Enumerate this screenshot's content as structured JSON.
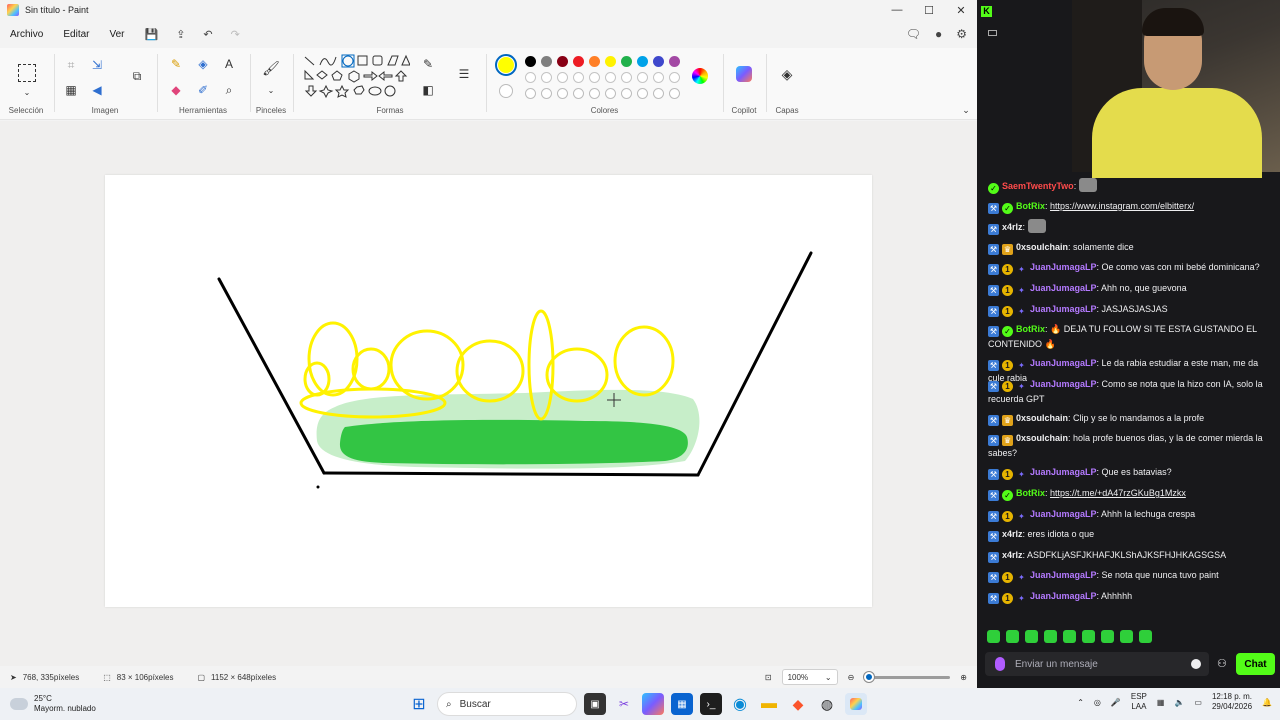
{
  "paint": {
    "title": "Sin título - Paint",
    "window_controls": {
      "minimize": "—",
      "maximize": "☐",
      "close": "✕"
    },
    "menu": [
      "Archivo",
      "Editar",
      "Ver"
    ],
    "groups": {
      "seleccion": "Selección",
      "imagen": "Imagen",
      "herramientas": "Herramientas",
      "pinceles": "Pinceles",
      "formas": "Formas",
      "colores": "Colores",
      "copilot": "Copilot",
      "capas": "Capas"
    },
    "active_color": "#ffff00",
    "palette": [
      "#000000",
      "#7f7f7f",
      "#880015",
      "#ed1c24",
      "#ff7f27",
      "#fff200",
      "#22b14c",
      "#00a2e8",
      "#3f48cc",
      "#a349a4",
      "#ffffff",
      "#c3c3c3",
      "#b97a57",
      "#ffaec9",
      "#ffc90e",
      "#efe4b0",
      "#b5e61d",
      "#99d9ea",
      "#7092be",
      "#c8bfe7"
    ],
    "status": {
      "cursor_pos": "768, 335píxeles",
      "selection_size": "83 × 106píxeles",
      "canvas_size": "1152 × 648píxeles",
      "zoom": "100%"
    },
    "zoom_fraction": 0.05
  },
  "stream": {
    "chat": [
      {
        "user": "SaemTwentyTwo",
        "color": "#ff4b4b",
        "badges": [
          "green"
        ],
        "text": "",
        "emote": true
      },
      {
        "user": "BotRix",
        "color": "#53fc18",
        "badges": [
          "blue",
          "green"
        ],
        "text": "https://www.instagram.com/elbitterx/",
        "link": true
      },
      {
        "user": "x4rlz",
        "color": "#efeff1",
        "badges": [
          "blue"
        ],
        "text": "",
        "emote": true
      },
      {
        "user": "0xsoulchain",
        "color": "#efeff1",
        "badges": [
          "blue",
          "crown"
        ],
        "text": "solamente dice"
      },
      {
        "user": "JuanJumagaLP",
        "color": "#b47aff",
        "badges": [
          "blue",
          "gold",
          "star"
        ],
        "text": "Oe como vas con mi bebé dominicana?"
      },
      {
        "user": "JuanJumagaLP",
        "color": "#b47aff",
        "badges": [
          "blue",
          "gold",
          "star"
        ],
        "text": "Ahh no, que guevona"
      },
      {
        "user": "JuanJumagaLP",
        "color": "#b47aff",
        "badges": [
          "blue",
          "gold",
          "star"
        ],
        "text": "JASJASJASJAS"
      },
      {
        "user": "BotRix",
        "color": "#53fc18",
        "badges": [
          "blue",
          "green"
        ],
        "text": "🔥 DEJA TU FOLLOW SI TE ESTA GUSTANDO EL CONTENIDO 🔥"
      },
      {
        "user": "JuanJumagaLP",
        "color": "#b47aff",
        "badges": [
          "blue",
          "gold",
          "star"
        ],
        "text": "Le da rabia estudiar a este man, me da cule rabia"
      },
      {
        "user": "JuanJumagaLP",
        "color": "#b47aff",
        "badges": [
          "blue",
          "gold",
          "star"
        ],
        "text": "Como se nota que la hizo con IA, solo la recuerda GPT"
      },
      {
        "user": "0xsoulchain",
        "color": "#efeff1",
        "badges": [
          "blue",
          "crown"
        ],
        "text": "Clip y se lo mandamos a la profe"
      },
      {
        "user": "0xsoulchain",
        "color": "#efeff1",
        "badges": [
          "blue",
          "crown"
        ],
        "text": "hola profe buenos dias, y la de comer mierda la sabes?"
      },
      {
        "user": "JuanJumagaLP",
        "color": "#b47aff",
        "badges": [
          "blue",
          "gold",
          "star"
        ],
        "text": "Que es batavias?"
      },
      {
        "user": "BotRix",
        "color": "#53fc18",
        "badges": [
          "blue",
          "green"
        ],
        "text": "https://t.me/+dA47rzGKuBg1Mzkx",
        "link": true
      },
      {
        "user": "JuanJumagaLP",
        "color": "#b47aff",
        "badges": [
          "blue",
          "gold",
          "star"
        ],
        "text": "Ahhh la lechuga crespa"
      },
      {
        "user": "x4rlz",
        "color": "#efeff1",
        "badges": [
          "blue"
        ],
        "text": "eres idiota o que"
      },
      {
        "user": "x4rlz",
        "color": "#efeff1",
        "badges": [
          "blue"
        ],
        "text": "ASDFKLjASFJKHAFJKLShAJKSFHJHKAGSGSA"
      },
      {
        "user": "JuanJumagaLP",
        "color": "#b47aff",
        "badges": [
          "blue",
          "gold",
          "star"
        ],
        "text": "Se nota que nunca tuvo paint"
      },
      {
        "user": "JuanJumagaLP",
        "color": "#b47aff",
        "badges": [
          "blue",
          "gold",
          "star"
        ],
        "text": "Ahhhhh"
      }
    ],
    "input_placeholder": "Enviar un mensaje",
    "chat_button": "Chat"
  },
  "taskbar": {
    "weather_temp": "25°C",
    "weather_desc": "Mayorm. nublado",
    "search": "Buscar",
    "lang_top": "ESP",
    "lang_bottom": "LAA",
    "time": "12:18 p. m.",
    "date": "29/04/2026"
  }
}
